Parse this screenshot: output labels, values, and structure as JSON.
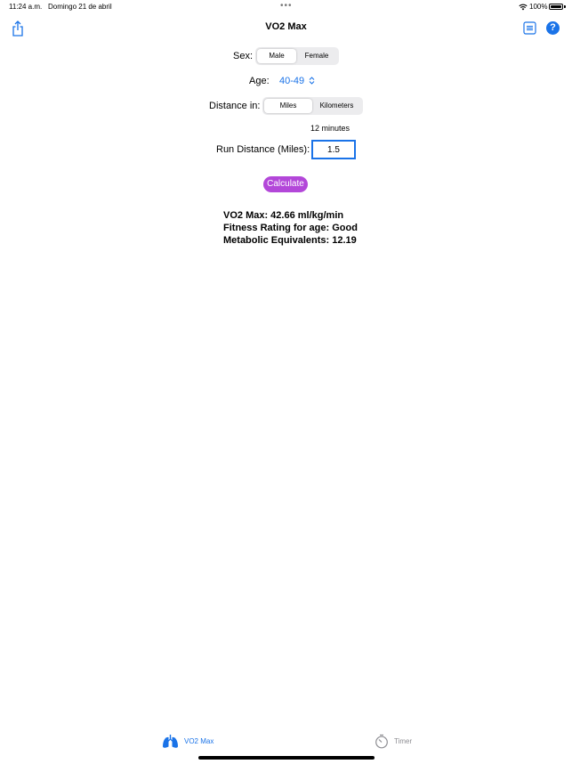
{
  "status": {
    "time": "11:24 a.m.",
    "date": "Domingo 21 de abril",
    "battery": "100%"
  },
  "nav": {
    "title": "VO2 Max",
    "help_label": "?"
  },
  "form": {
    "sex_label": "Sex:",
    "sex_options": [
      "Male",
      "Female"
    ],
    "sex_selected": "Male",
    "age_label": "Age:",
    "age_value": "40-49",
    "distance_label": "Distance in:",
    "distance_options": [
      "Miles",
      "Kilometers"
    ],
    "distance_selected": "Miles",
    "duration": "12 minutes",
    "run_distance_label": "Run Distance (Miles):",
    "run_distance_value": "1.5",
    "calculate_label": "Calculate"
  },
  "results": {
    "vo2": "VO2 Max: 42.66 ml/kg/min",
    "fitness": "Fitness Rating for age: Good",
    "met": "Metabolic Equivalents: 12.19"
  },
  "tabs": [
    {
      "label": "VO2 Max",
      "icon": "lungs-icon",
      "active": true
    },
    {
      "label": "Timer",
      "icon": "stopwatch-icon",
      "active": false
    }
  ],
  "colors": {
    "accent": "#1a73e8",
    "calculate": "#b347d9",
    "inactive_tab": "#8e8e93"
  }
}
